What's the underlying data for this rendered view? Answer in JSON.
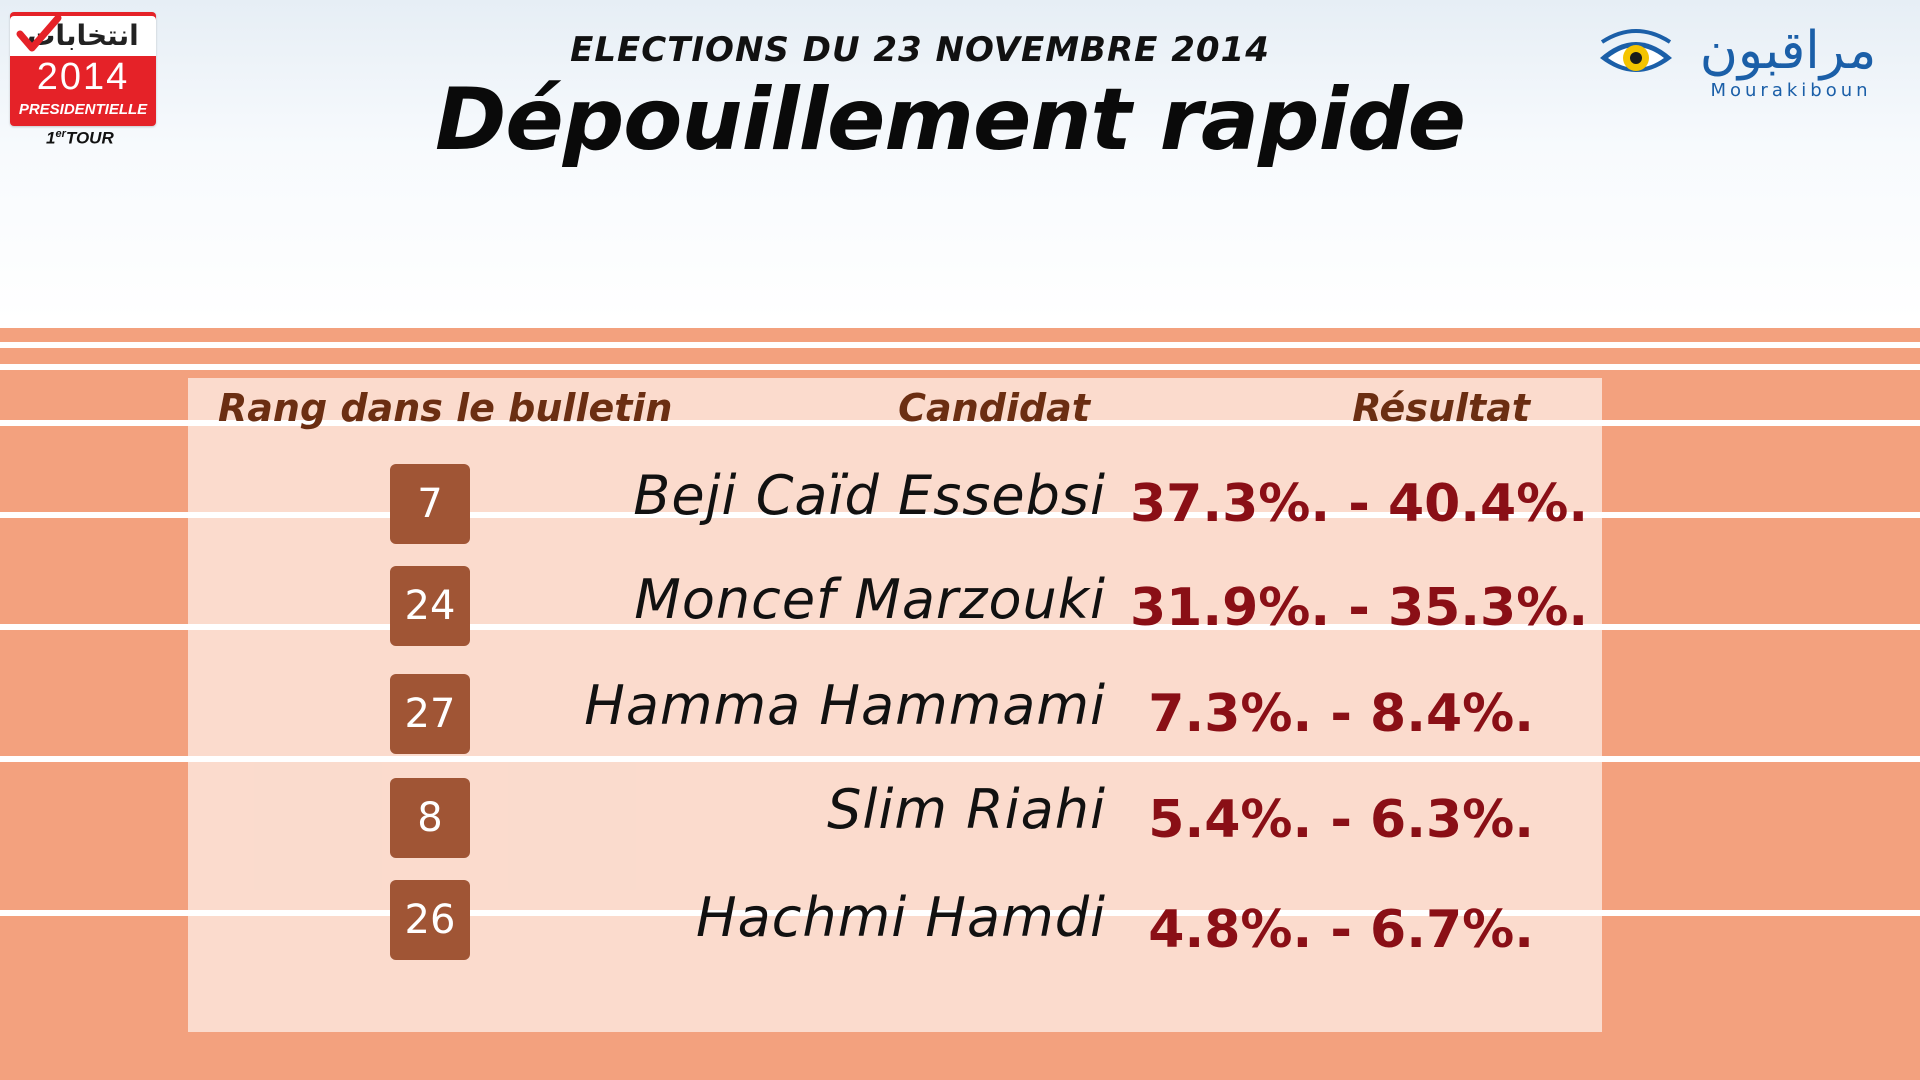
{
  "header": {
    "subtitle": "ELECTIONS DU 23 NOVEMBRE 2014",
    "title": "Dépouillement rapide"
  },
  "logo_left": {
    "arabic": "انتخابات",
    "year": "2014",
    "label": "PRESIDENTIELLE",
    "tour_num": "1",
    "tour_sup": "er",
    "tour_word": "TOUR"
  },
  "logo_right": {
    "arabic": "مراقبون",
    "latin": "Mourakiboun"
  },
  "table": {
    "headers": {
      "rank": "Rang dans le bulletin",
      "candidate": "Candidat",
      "result": "Résultat"
    },
    "rows": [
      {
        "rank": "7",
        "candidate": "Beji Caïd Essebsi",
        "result": "37.3%. - 40.4%."
      },
      {
        "rank": "24",
        "candidate": "Moncef  Marzouki",
        "result": "31.9%. - 35.3%."
      },
      {
        "rank": "27",
        "candidate": "Hamma Hammami",
        "result": "7.3%. - 8.4%."
      },
      {
        "rank": "8",
        "candidate": "Slim Riahi",
        "result": "5.4%. - 6.3%."
      },
      {
        "rank": "26",
        "candidate": "Hachmi Hamdi",
        "result": "4.8%. - 6.7%."
      }
    ]
  },
  "colors": {
    "band": "#f3a17e",
    "badge": "#a05535",
    "result": "#8a0f16",
    "header_text": "#6b2e12",
    "logo_red": "#e52228",
    "logo_blue": "#1b5fa8"
  }
}
